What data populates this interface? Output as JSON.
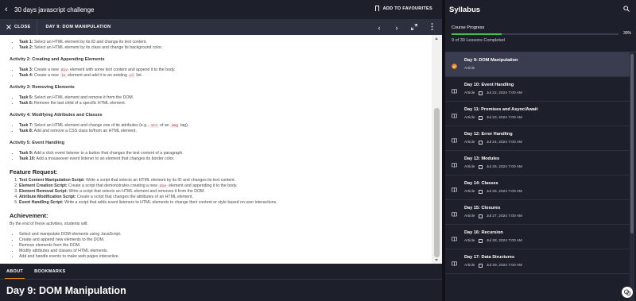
{
  "topbar": {
    "course_title": "30 days javascript challenge",
    "favourites_label": "ADD TO FAVOURITES"
  },
  "lessonbar": {
    "close_label": "CLOSE",
    "lesson_name": "DAY 9: DOM MANIPULATION"
  },
  "content": {
    "activity1_tasks": [
      {
        "label": "Task 1:",
        "text": "Select an HTML element by its ID and change its text content."
      },
      {
        "label": "Task 2:",
        "text": "Select an HTML element by its class and change its background color."
      }
    ],
    "activity2": {
      "title": "Activity 2: Creating and Appending Elements",
      "task3": {
        "label": "Task 3:",
        "pre": "Create a new",
        "code": "div",
        "post": "element with some text content and append it to the body."
      },
      "task4": {
        "label": "Task 4:",
        "pre": "Create a new",
        "code": "li",
        "mid": "element and add it to an existing",
        "code2": "ul",
        "post": "list."
      }
    },
    "activity3": {
      "title": "Activity 3: Removing Elements",
      "task5": {
        "label": "Task 5:",
        "text": "Select an HTML element and remove it from the DOM."
      },
      "task6": {
        "label": "Task 6:",
        "text": "Remove the last child of a specific HTML element."
      }
    },
    "activity4": {
      "title": "Activity 4: Modifying Attributes and Classes",
      "task7": {
        "label": "Task 7:",
        "pre": "Select an HTML element and change one of its attributes (e.g.,",
        "code": "src",
        "mid": "of an",
        "code2": "img",
        "post": "tag)."
      },
      "task8": {
        "label": "Task 8:",
        "text": "Add and remove a CSS class to/from an HTML element."
      }
    },
    "activity5": {
      "title": "Activity 5: Event Handling",
      "task9": {
        "label": "Task 9:",
        "text": "Add a click event listener to a button that changes the text content of a paragraph."
      },
      "task10": {
        "label": "Task 10:",
        "text": "Add a mouseover event listener to an element that changes its border color."
      }
    },
    "feature": {
      "title": "Feature Request:",
      "items": [
        {
          "label": "Text Content Manipulation Script:",
          "text": "Write a script that selects an HTML element by its ID and changes its text content."
        },
        {
          "label": "Element Creation Script:",
          "pre": "Create a script that demonstrates creating a new",
          "code": "div",
          "post": "element and appending it to the body."
        },
        {
          "label": "Element Removal Script:",
          "text": "Write a script that selects an HTML element and removes it from the DOM."
        },
        {
          "label": "Attribute Modification Script:",
          "text": "Create a script that changes the attributes of an HTML element."
        },
        {
          "label": "Event Handling Script:",
          "text": "Write a script that adds event listeners to HTML elements to change their content or style based on user interactions."
        }
      ]
    },
    "achievement": {
      "title": "Achievement:",
      "intro": "By the end of these activities, students will:",
      "items": [
        "Select and manipulate DOM elements using JavaScript.",
        "Create and append new elements to the DOM.",
        "Remove elements from the DOM.",
        "Modify attributes and classes of HTML elements.",
        "Add and handle events to make web pages interactive."
      ]
    }
  },
  "tabs": {
    "about": "ABOUT",
    "bookmarks": "BOOKMARKS"
  },
  "page_title": "Day 9: DOM Manipulation",
  "syllabus": {
    "title": "Syllabus",
    "progress_label": "Course Progress",
    "progress_percent_text": "30%",
    "progress_fraction": 0.3,
    "completed_text": "9 of 30 Lessons Completed",
    "lessons": [
      {
        "title": "Day 9: DOM Manipulation",
        "type": "Article",
        "date": ""
      },
      {
        "title": "Day 10: Event Handling",
        "type": "Article",
        "date": "Jul 22, 2024 7:00 AM"
      },
      {
        "title": "Day 11: Promises and Async/Await",
        "type": "Article",
        "date": "Jul 23, 2024 7:00 AM"
      },
      {
        "title": "Day 12: Error Handling",
        "type": "Article",
        "date": "Jul 24, 2024 7:00 AM"
      },
      {
        "title": "Day 13: Modules",
        "type": "Article",
        "date": "Jul 25, 2024 7:00 AM"
      },
      {
        "title": "Day 14: Classes",
        "type": "Article",
        "date": "Jul 26, 2024 7:00 AM"
      },
      {
        "title": "Day 15: Closures",
        "type": "Article",
        "date": "Jul 27, 2024 7:00 AM"
      },
      {
        "title": "Day 16: Recursion",
        "type": "Article",
        "date": "Jul 28, 2024 7:00 AM"
      },
      {
        "title": "Day 17: Data Structures",
        "type": "Article",
        "date": "Jul 29, 2024 7:00 AM"
      }
    ]
  },
  "colors": {
    "accent": "#f28b1e",
    "progress": "#3fbf4f",
    "dark_bg": "#1d1f2b"
  }
}
